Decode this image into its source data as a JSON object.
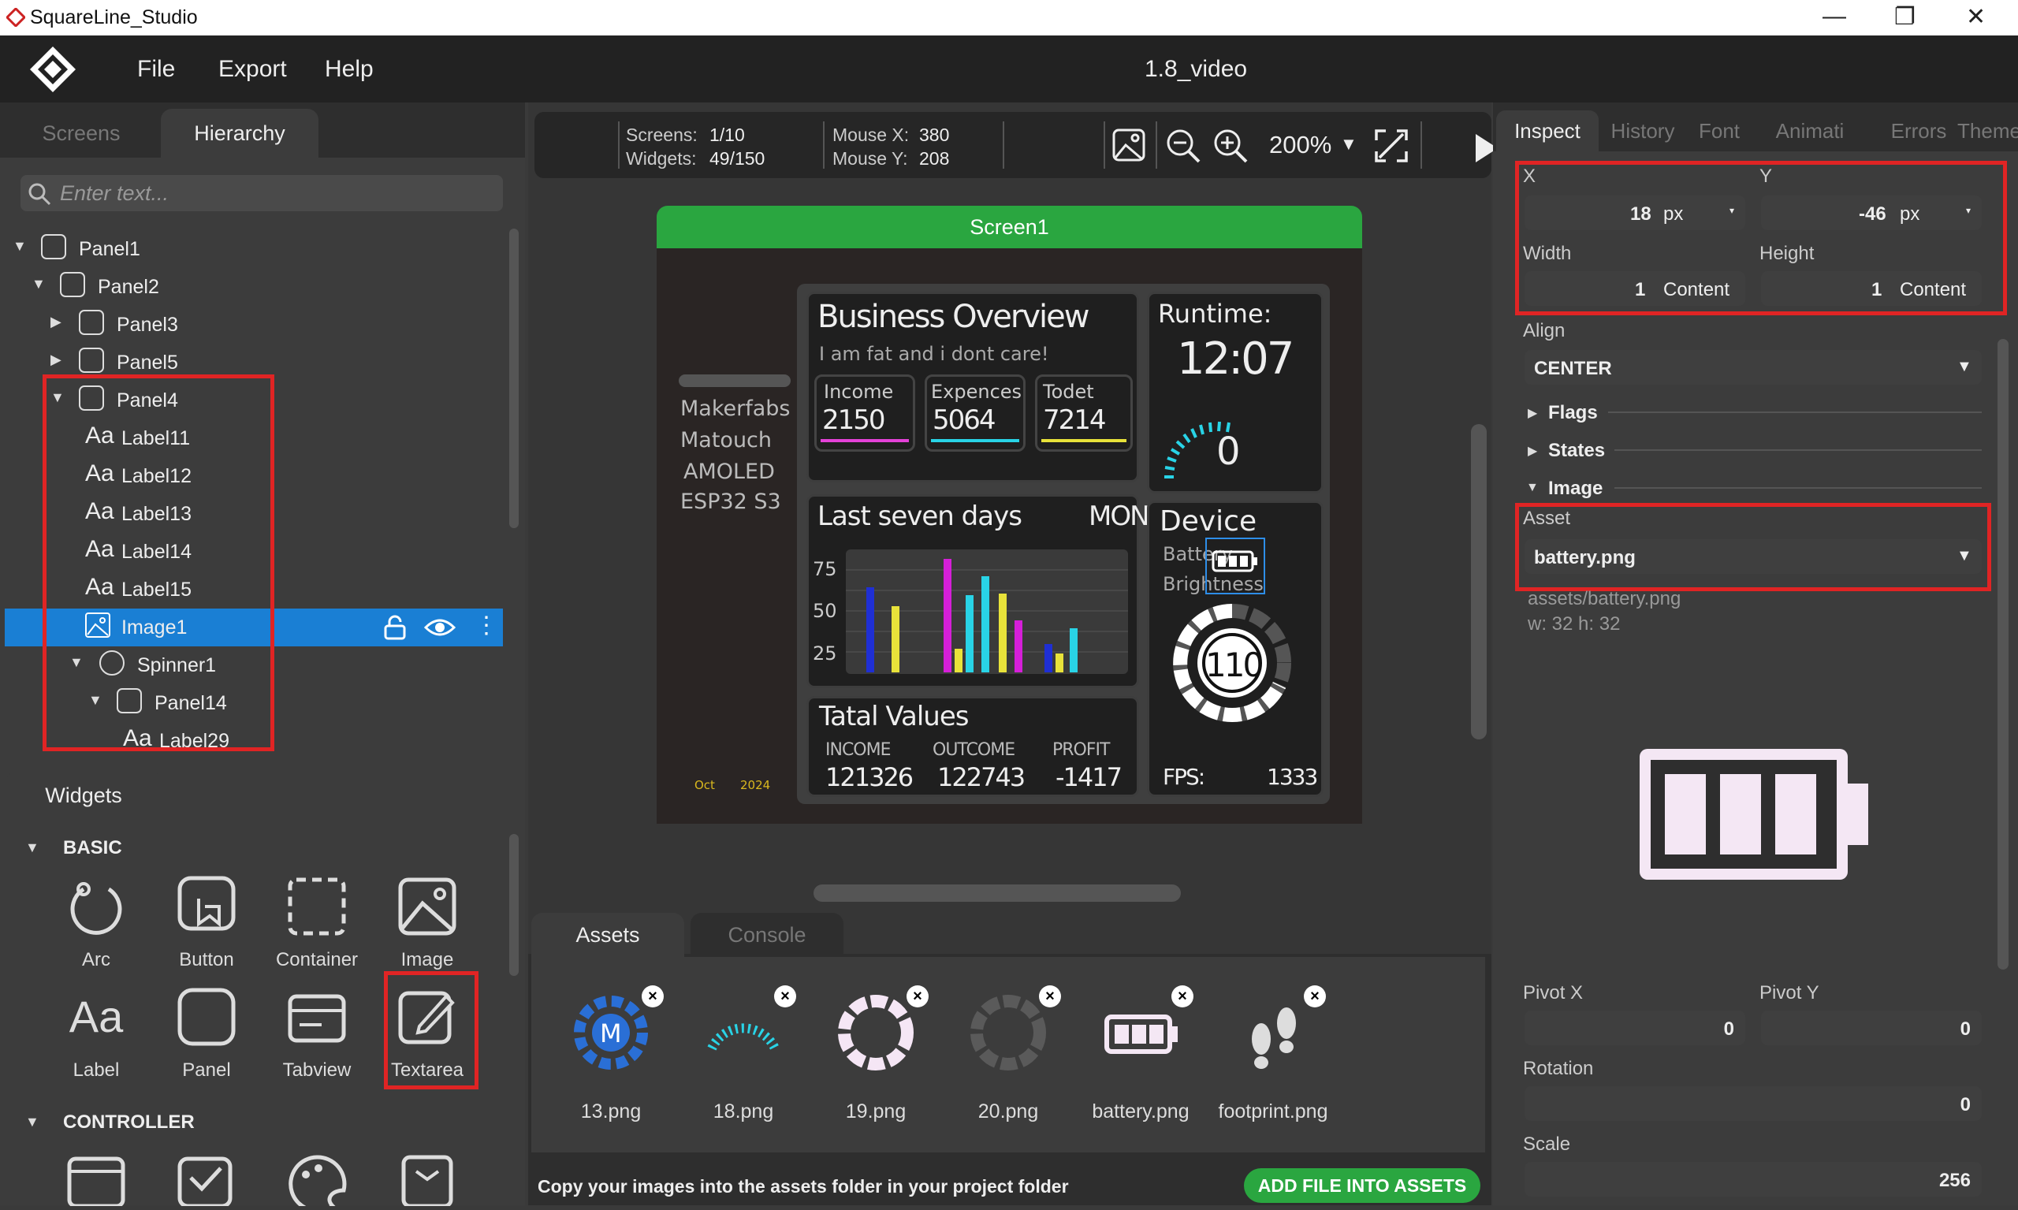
{
  "window": {
    "title": "SquareLine_Studio",
    "min": "—",
    "max": "❐",
    "close": "✕"
  },
  "menu": {
    "file": "File",
    "export": "Export",
    "help": "Help",
    "project": "1.8_video"
  },
  "left_tabs": {
    "screens": "Screens",
    "hierarchy": "Hierarchy"
  },
  "search": {
    "placeholder": "Enter text..."
  },
  "tree": [
    {
      "label": "Panel1",
      "kind": "panel",
      "depth": 0,
      "arrow": "▼"
    },
    {
      "label": "Panel2",
      "kind": "panel",
      "depth": 1,
      "arrow": "▼"
    },
    {
      "label": "Panel3",
      "kind": "panel",
      "depth": 2,
      "arrow": "▶"
    },
    {
      "label": "Panel5",
      "kind": "panel",
      "depth": 2,
      "arrow": "▶"
    },
    {
      "label": "Panel4",
      "kind": "panel",
      "depth": 2,
      "arrow": "▼"
    },
    {
      "label": "Label11",
      "kind": "label",
      "depth": 3,
      "arrow": ""
    },
    {
      "label": "Label12",
      "kind": "label",
      "depth": 3,
      "arrow": ""
    },
    {
      "label": "Label13",
      "kind": "label",
      "depth": 3,
      "arrow": ""
    },
    {
      "label": "Label14",
      "kind": "label",
      "depth": 3,
      "arrow": ""
    },
    {
      "label": "Label15",
      "kind": "label",
      "depth": 3,
      "arrow": ""
    },
    {
      "label": "Image1",
      "kind": "image",
      "depth": 3,
      "arrow": ""
    },
    {
      "label": "Spinner1",
      "kind": "spinner",
      "depth": 3,
      "arrow": "▼"
    },
    {
      "label": "Panel14",
      "kind": "panel",
      "depth": 4,
      "arrow": "▼"
    },
    {
      "label": "Label29",
      "kind": "label",
      "depth": 5,
      "arrow": ""
    }
  ],
  "widgets": {
    "tab": "Widgets",
    "basic": "BASIC",
    "controller": "CONTROLLER",
    "items": [
      "Arc",
      "Button",
      "Container",
      "Image",
      "Label",
      "Panel",
      "Tabview",
      "Textarea"
    ]
  },
  "toolbar": {
    "screens_k": "Screens:",
    "screens_v": "1/10",
    "widgets_k": "Widgets:",
    "widgets_v": "49/150",
    "mx_k": "Mouse X:",
    "mx_v": "380",
    "my_k": "Mouse Y:",
    "my_v": "208",
    "zoom": "200%"
  },
  "screen": {
    "name": "Screen1",
    "title": "Business Overview",
    "subtitle": "I am fat and i dont care!",
    "income_l": "Income",
    "income_v": "2150",
    "exp_l": "Expences",
    "exp_v": "5064",
    "tod_l": "Todet",
    "tod_v": "7214",
    "runtime_l": "Runtime:",
    "runtime_v": "12:07",
    "runtime_n": "0",
    "brand": [
      "Makerfabs",
      "Matouch",
      "AMOLED",
      "ESP32 S3"
    ],
    "last7": "Last seven days",
    "day": "MON",
    "yticks": [
      "75",
      "50",
      "25"
    ],
    "device": "Device",
    "battery": "Battery",
    "bright": "Brightness",
    "gauge": "110",
    "total": "Tatal Values",
    "inc_k": "INCOME",
    "inc_v": "121326",
    "out_k": "OUTCOME",
    "out_v": "122743",
    "pro_k": "PROFIT",
    "pro_v": "-1417",
    "fps_k": "FPS:",
    "fps_v": "1333",
    "month": "Oct",
    "year": "2024"
  },
  "bottom_tabs": {
    "assets": "Assets",
    "console": "Console"
  },
  "assets": [
    "13.png",
    "18.png",
    "19.png",
    "20.png",
    "battery.png",
    "footprint.png"
  ],
  "assets_hint": "Copy your images into the assets folder in your project folder",
  "add_btn": "ADD FILE INTO ASSETS",
  "right_tabs": [
    "Inspect",
    "History",
    "Font",
    "Animati",
    "Errors",
    "Themes"
  ],
  "inspect": {
    "x_l": "X",
    "y_l": "Y",
    "x_v": "18",
    "y_v": "-46",
    "unit": "px",
    "w_l": "Width",
    "h_l": "Height",
    "w_v": "1",
    "h_v": "1",
    "wunit": "Content",
    "align_l": "Align",
    "align_v": "CENTER",
    "flags": "Flags",
    "states": "States",
    "image": "Image",
    "asset_l": "Asset",
    "asset_v": "battery.png",
    "path": "assets/battery.png",
    "dims": "w: 32  h: 32",
    "pivx_l": "Pivot X",
    "pivy_l": "Pivot Y",
    "pivx_v": "0",
    "pivy_v": "0",
    "rot_l": "Rotation",
    "rot_v": "0",
    "scale_l": "Scale",
    "scale_v": "256"
  },
  "colors": {
    "accent": "#1a7fd4",
    "green": "#2aa640",
    "red": "#e02424"
  }
}
